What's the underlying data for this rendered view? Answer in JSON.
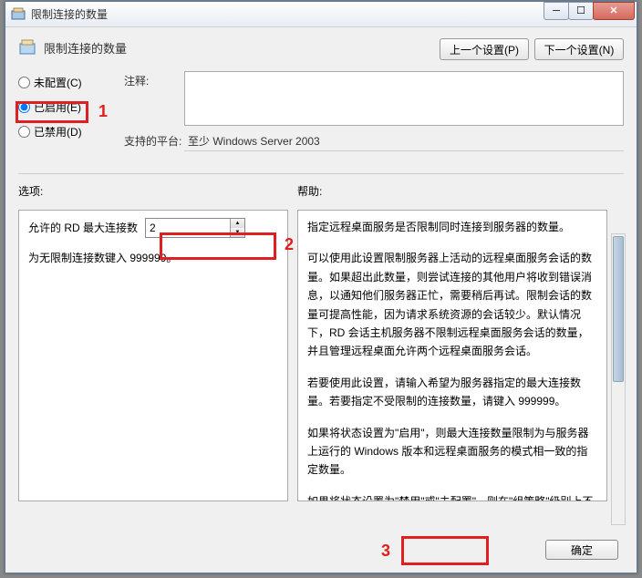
{
  "window": {
    "title": "限制连接的数量"
  },
  "header": {
    "title": "限制连接的数量"
  },
  "nav": {
    "prev": "上一个设置(P)",
    "next": "下一个设置(N)"
  },
  "radios": {
    "not_configured": "未配置(C)",
    "enabled": "已启用(E)",
    "disabled": "已禁用(D)"
  },
  "fields": {
    "comment_label": "注释:",
    "comment_value": "",
    "platform_label": "支持的平台:",
    "platform_value": "至少 Windows Server 2003"
  },
  "sections": {
    "options": "选项:",
    "help": "帮助:"
  },
  "options": {
    "max_conn_label": "允许的 RD 最大连接数",
    "max_conn_value": "2",
    "unlimited_note": "为无限制连接数键入 999999。"
  },
  "help_text": {
    "p1": "指定远程桌面服务是否限制同时连接到服务器的数量。",
    "p2": "可以使用此设置限制服务器上活动的远程桌面服务会话的数量。如果超出此数量，则尝试连接的其他用户将收到错误消息，以通知他们服务器正忙，需要稍后再试。限制会话的数量可提高性能，因为请求系统资源的会话较少。默认情况下，RD 会话主机服务器不限制远程桌面服务会话的数量，并且管理远程桌面允许两个远程桌面服务会话。",
    "p3": "若要使用此设置，请输入希望为服务器指定的最大连接数量。若要指定不受限制的连接数量，请键入 999999。",
    "p4": "如果将状态设置为\"启用\"，则最大连接数量限制为与服务器上运行的 Windows 版本和远程桌面服务的模式相一致的指定数量。",
    "p5": "如果将状态设置为\"禁用\"或\"未配置\"，则在\"组策略\"级别上不强制限制连接的数量。"
  },
  "footer": {
    "ok": "确定"
  },
  "annotations": {
    "a1": "1",
    "a2": "2",
    "a3": "3"
  }
}
